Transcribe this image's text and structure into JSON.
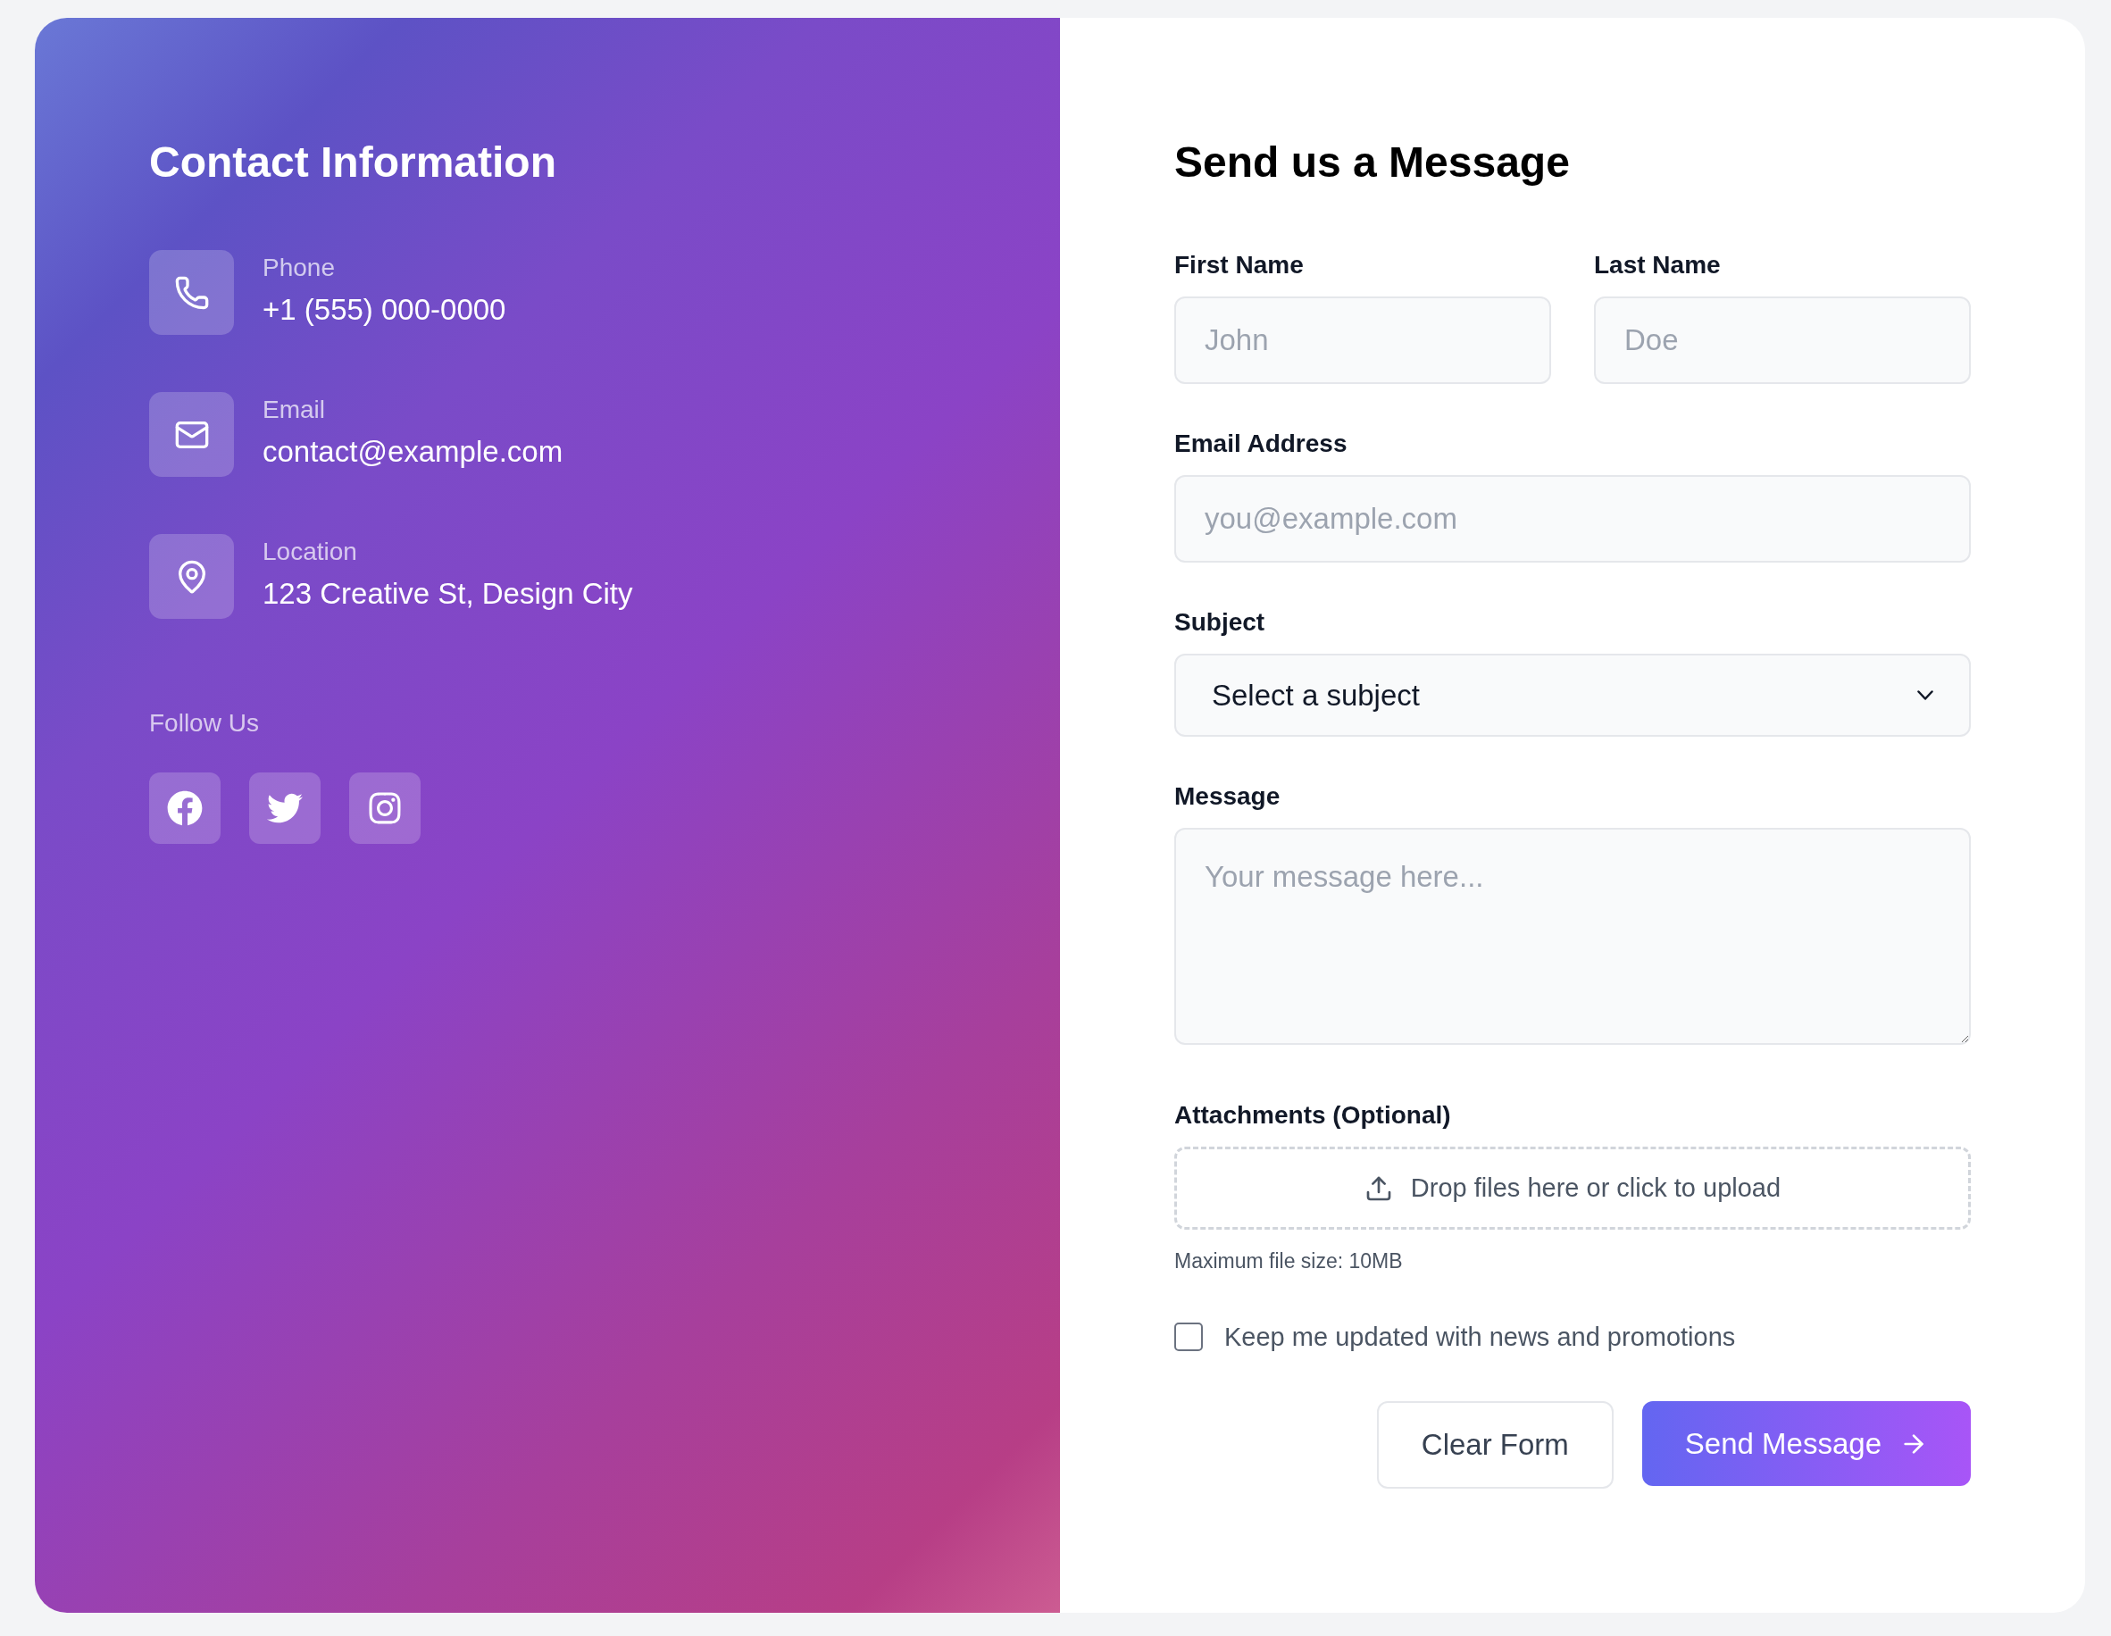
{
  "contact": {
    "title": "Contact Information",
    "items": [
      {
        "kind": "phone",
        "label": "Phone",
        "value": "+1 (555) 000-0000"
      },
      {
        "kind": "email",
        "label": "Email",
        "value": "contact@example.com"
      },
      {
        "kind": "location",
        "label": "Location",
        "value": "123 Creative St, Design City"
      }
    ],
    "follow_label": "Follow Us",
    "socials": [
      {
        "kind": "facebook"
      },
      {
        "kind": "twitter"
      },
      {
        "kind": "instagram"
      }
    ]
  },
  "form": {
    "title": "Send us a Message",
    "first_name": {
      "label": "First Name",
      "placeholder": "John"
    },
    "last_name": {
      "label": "Last Name",
      "placeholder": "Doe"
    },
    "email": {
      "label": "Email Address",
      "placeholder": "you@example.com"
    },
    "subject": {
      "label": "Subject",
      "value": "Select a subject"
    },
    "message": {
      "label": "Message",
      "placeholder": "Your message here..."
    },
    "attachments": {
      "label": "Attachments (Optional)",
      "dropzone": "Drop files here or click to upload",
      "hint": "Maximum file size: 10MB"
    },
    "newsletter": {
      "label": "Keep me updated with news and promotions",
      "checked": false
    },
    "buttons": [
      {
        "kind": "secondary",
        "label": "Clear Form"
      },
      {
        "kind": "primary",
        "label": "Send Message"
      }
    ]
  }
}
